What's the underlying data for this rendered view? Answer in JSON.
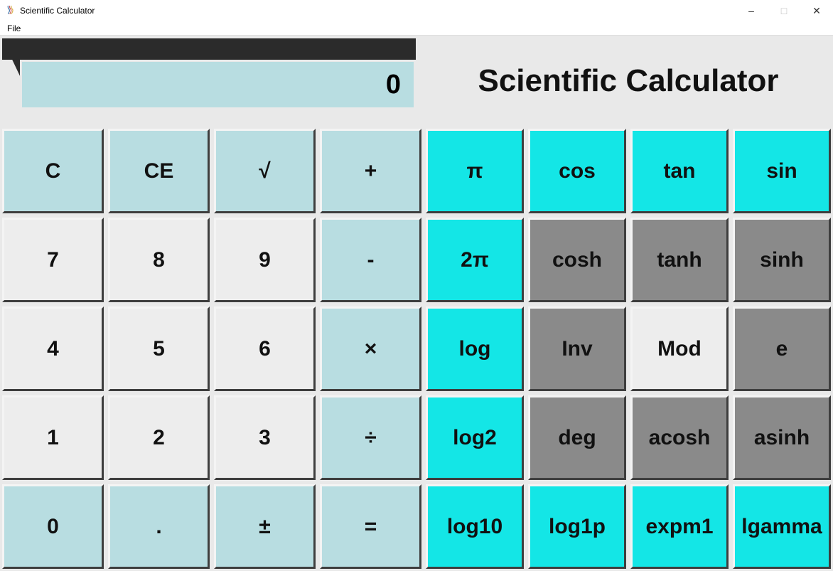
{
  "window": {
    "title": "Scientific Calculator"
  },
  "menubar": {
    "file": "File"
  },
  "display": {
    "value": "0"
  },
  "heading": "Scientific Calculator",
  "left_buttons": {
    "r0c0": "C",
    "r0c1": "CE",
    "r0c2": "√",
    "r0c3": "+",
    "r1c0": "7",
    "r1c1": "8",
    "r1c2": "9",
    "r1c3": "-",
    "r2c0": "4",
    "r2c1": "5",
    "r2c2": "6",
    "r2c3": "×",
    "r3c0": "1",
    "r3c1": "2",
    "r3c2": "3",
    "r3c3": "÷",
    "r4c0": "0",
    "r4c1": ".",
    "r4c2": "±",
    "r4c3": "="
  },
  "right_buttons": {
    "r0c0": "π",
    "r0c1": "cos",
    "r0c2": "tan",
    "r0c3": "sin",
    "r1c0": "2π",
    "r1c1": "cosh",
    "r1c2": "tanh",
    "r1c3": "sinh",
    "r2c0": "log",
    "r2c1": "Inv",
    "r2c2": "Mod",
    "r2c3": "e",
    "r3c0": "log2",
    "r3c1": "deg",
    "r3c2": "acosh",
    "r3c3": "asinh",
    "r4c0": "log10",
    "r4c1": "log1p",
    "r4c2": "expm1",
    "r4c3": "lgamma"
  }
}
